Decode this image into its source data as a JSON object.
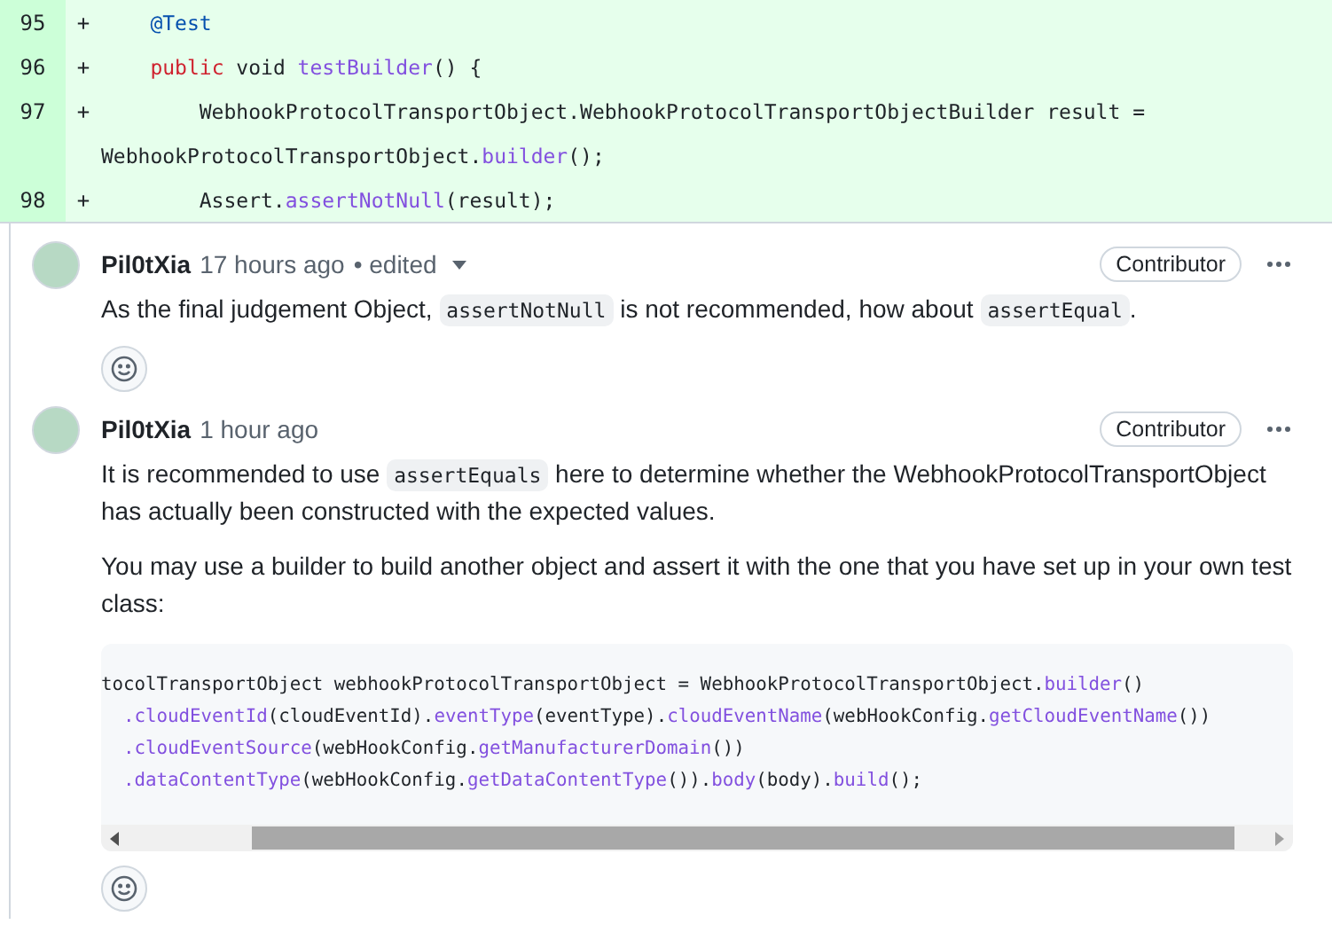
{
  "diff": {
    "lines": [
      {
        "number": "95",
        "sign": "+",
        "rows": [
          [
            {
              "kind": "plain",
              "text": "    "
            },
            {
              "kind": "annotation",
              "text": "@Test"
            }
          ]
        ]
      },
      {
        "number": "96",
        "sign": "+",
        "rows": [
          [
            {
              "kind": "plain",
              "text": "    "
            },
            {
              "kind": "keyword",
              "text": "public"
            },
            {
              "kind": "plain",
              "text": " void "
            },
            {
              "kind": "func",
              "text": "testBuilder"
            },
            {
              "kind": "plain",
              "text": "() {"
            }
          ]
        ]
      },
      {
        "number": "97",
        "sign": "+",
        "rows": [
          [
            {
              "kind": "plain",
              "text": "        WebhookProtocolTransportObject.WebhookProtocolTransportObjectBuilder result ="
            }
          ],
          [
            {
              "kind": "plain",
              "text": "WebhookProtocolTransportObject."
            },
            {
              "kind": "func",
              "text": "builder"
            },
            {
              "kind": "plain",
              "text": "();"
            }
          ]
        ]
      },
      {
        "number": "98",
        "sign": "+",
        "rows": [
          [
            {
              "kind": "plain",
              "text": "        Assert."
            },
            {
              "kind": "func",
              "text": "assertNotNull"
            },
            {
              "kind": "plain",
              "text": "(result);"
            }
          ]
        ]
      }
    ]
  },
  "comments": [
    {
      "author": "Pil0tXia",
      "time": "17 hours ago",
      "edited": "• edited",
      "badge": "Contributor",
      "paragraphs": [
        [
          {
            "kind": "text",
            "text": "As the final judgement Object, "
          },
          {
            "kind": "code",
            "text": "assertNotNull"
          },
          {
            "kind": "text",
            "text": " is not recommended, how about "
          },
          {
            "kind": "code",
            "text": "assertEqual"
          },
          {
            "kind": "text",
            "text": "."
          }
        ]
      ]
    },
    {
      "author": "Pil0tXia",
      "time": "1 hour ago",
      "badge": "Contributor",
      "paragraphs": [
        [
          {
            "kind": "text",
            "text": "It is recommended to use "
          },
          {
            "kind": "code",
            "text": "assertEquals"
          },
          {
            "kind": "text",
            "text": " here to determine whether the WebhookProtocolTransportObject has actually been constructed with the expected values."
          }
        ],
        [
          {
            "kind": "text",
            "text": "You may use a builder to build another object and assert it with the one that you have set up in your own test class:"
          }
        ]
      ],
      "code": [
        [
          {
            "kind": "plain",
            "text": "tocolTransportObject webhookProtocolTransportObject = WebhookProtocolTransportObject."
          },
          {
            "kind": "func",
            "text": "builder"
          },
          {
            "kind": "plain",
            "text": "()"
          }
        ],
        [
          {
            "kind": "func",
            "text": "  .cloudEventId"
          },
          {
            "kind": "plain",
            "text": "(cloudEventId)."
          },
          {
            "kind": "func",
            "text": "eventType"
          },
          {
            "kind": "plain",
            "text": "(eventType)."
          },
          {
            "kind": "func",
            "text": "cloudEventName"
          },
          {
            "kind": "plain",
            "text": "(webHookConfig."
          },
          {
            "kind": "func",
            "text": "getCloudEventName"
          },
          {
            "kind": "plain",
            "text": "())"
          }
        ],
        [
          {
            "kind": "func",
            "text": "  .cloudEventSource"
          },
          {
            "kind": "plain",
            "text": "(webHookConfig."
          },
          {
            "kind": "func",
            "text": "getManufacturerDomain"
          },
          {
            "kind": "plain",
            "text": "())"
          }
        ],
        [
          {
            "kind": "func",
            "text": "  .dataContentType"
          },
          {
            "kind": "plain",
            "text": "(webHookConfig."
          },
          {
            "kind": "func",
            "text": "getDataContentType"
          },
          {
            "kind": "plain",
            "text": "())."
          },
          {
            "kind": "func",
            "text": "body"
          },
          {
            "kind": "plain",
            "text": "(body)."
          },
          {
            "kind": "func",
            "text": "build"
          },
          {
            "kind": "plain",
            "text": "();"
          }
        ]
      ]
    }
  ]
}
